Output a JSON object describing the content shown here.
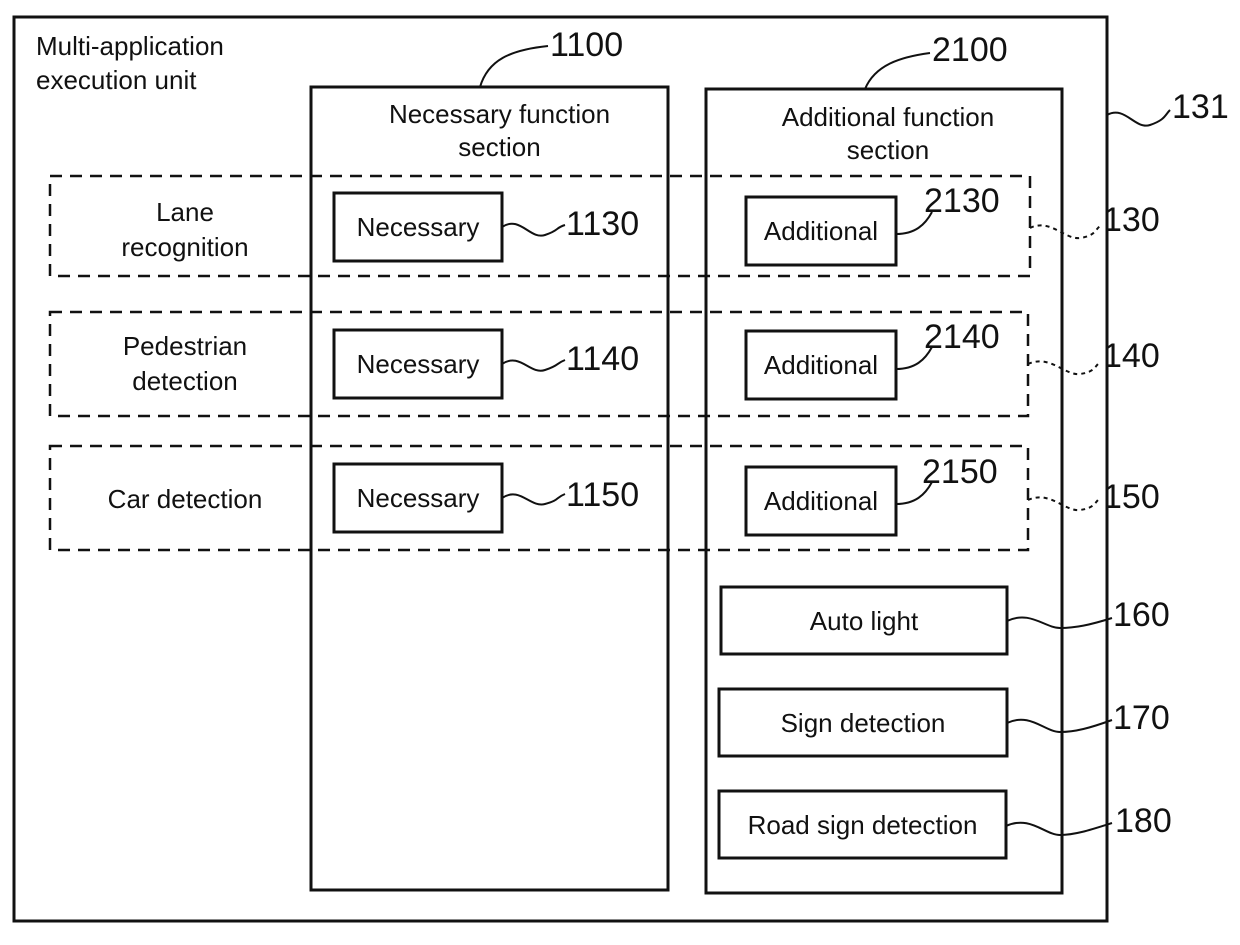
{
  "outer": {
    "title_line1": "Multi-application",
    "title_line2": "execution unit",
    "ref": "131"
  },
  "necessary_section": {
    "title_line1": "Necessary function",
    "title_line2": "section",
    "ref": "1100"
  },
  "additional_section": {
    "title_line1": "Additional function",
    "title_line2": "section",
    "ref": "2100"
  },
  "apps": [
    {
      "name_line1": "Lane",
      "name_line2": "recognition",
      "ref": "130",
      "necessary": {
        "label": "Necessary",
        "ref": "1130"
      },
      "additional": {
        "label": "Additional",
        "ref": "2130"
      }
    },
    {
      "name_line1": "Pedestrian",
      "name_line2": "detection",
      "ref": "140",
      "necessary": {
        "label": "Necessary",
        "ref": "1140"
      },
      "additional": {
        "label": "Additional",
        "ref": "2140"
      }
    },
    {
      "name_line1": "Car detection",
      "name_line2": "",
      "ref": "150",
      "necessary": {
        "label": "Necessary",
        "ref": "1150"
      },
      "additional": {
        "label": "Additional",
        "ref": "2150"
      }
    }
  ],
  "standalone": [
    {
      "label": "Auto light",
      "ref": "160"
    },
    {
      "label": "Sign detection",
      "ref": "170"
    },
    {
      "label": "Road sign detection",
      "ref": "180"
    }
  ]
}
